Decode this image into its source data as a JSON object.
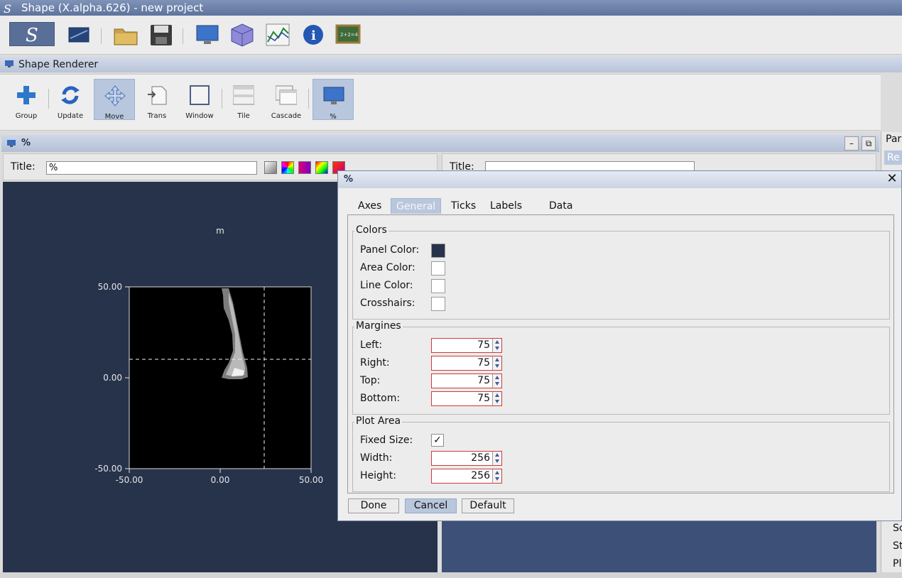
{
  "app": {
    "title": "Shape (X.alpha.626) - new project",
    "icon_glyph": "S"
  },
  "main_toolbar": {
    "icons": [
      "shape-logo-icon",
      "screen-icon",
      "folder-icon",
      "save-icon",
      "monitor-icon",
      "cube-icon",
      "chart-icon",
      "info-icon",
      "chalkboard-icon"
    ]
  },
  "renderer": {
    "title": "Shape Renderer",
    "buttons": [
      {
        "label": "Group",
        "icon": "plus-icon"
      },
      {
        "label": "Update",
        "icon": "refresh-icon"
      },
      {
        "label": "Move",
        "icon": "move-icon"
      },
      {
        "label": "Trans",
        "icon": "transform-icon"
      },
      {
        "label": "Window",
        "icon": "window-icon"
      },
      {
        "label": "Tile",
        "icon": "tile-icon"
      },
      {
        "label": "Cascade",
        "icon": "cascade-icon"
      },
      {
        "label": "%",
        "icon": "monitor-icon"
      }
    ]
  },
  "inner_window": {
    "title": "%",
    "title_label": "Title:",
    "title_value": "%",
    "second_title_label": "Title:"
  },
  "plot": {
    "header_label": "m",
    "y_ticks": [
      "50.00",
      "0.00",
      "-50.00"
    ],
    "x_ticks": [
      "-50.00",
      "0.00",
      "50.00"
    ]
  },
  "right_panel": {
    "top_label": "Par",
    "top_button": "Re",
    "bottom_labels": [
      "Sc",
      "St",
      "Pl"
    ]
  },
  "dialog": {
    "title": "%",
    "tabs": [
      "Axes",
      "General",
      "Ticks",
      "Labels",
      "Data"
    ],
    "active_tab": "General",
    "colors": {
      "title": "Colors",
      "panel_color_label": "Panel Color:",
      "area_color_label": "Area Color:",
      "line_color_label": "Line Color:",
      "crosshairs_label": "Crosshairs:",
      "panel_color": "#27334b",
      "area_color": "#ffffff",
      "line_color": "#ffffff",
      "crosshairs_color": "#ffffff"
    },
    "margins": {
      "title": "Margines",
      "left_label": "Left:",
      "right_label": "Right:",
      "top_label": "Top:",
      "bottom_label": "Bottom:",
      "left": "75",
      "right": "75",
      "top": "75",
      "bottom": "75"
    },
    "plot_area": {
      "title": "Plot Area",
      "fixed_size_label": "Fixed Size:",
      "fixed_size_check": "✓",
      "width_label": "Width:",
      "height_label": "Height:",
      "width": "256",
      "height": "256"
    },
    "buttons": {
      "done": "Done",
      "cancel": "Cancel",
      "default": "Default"
    }
  }
}
